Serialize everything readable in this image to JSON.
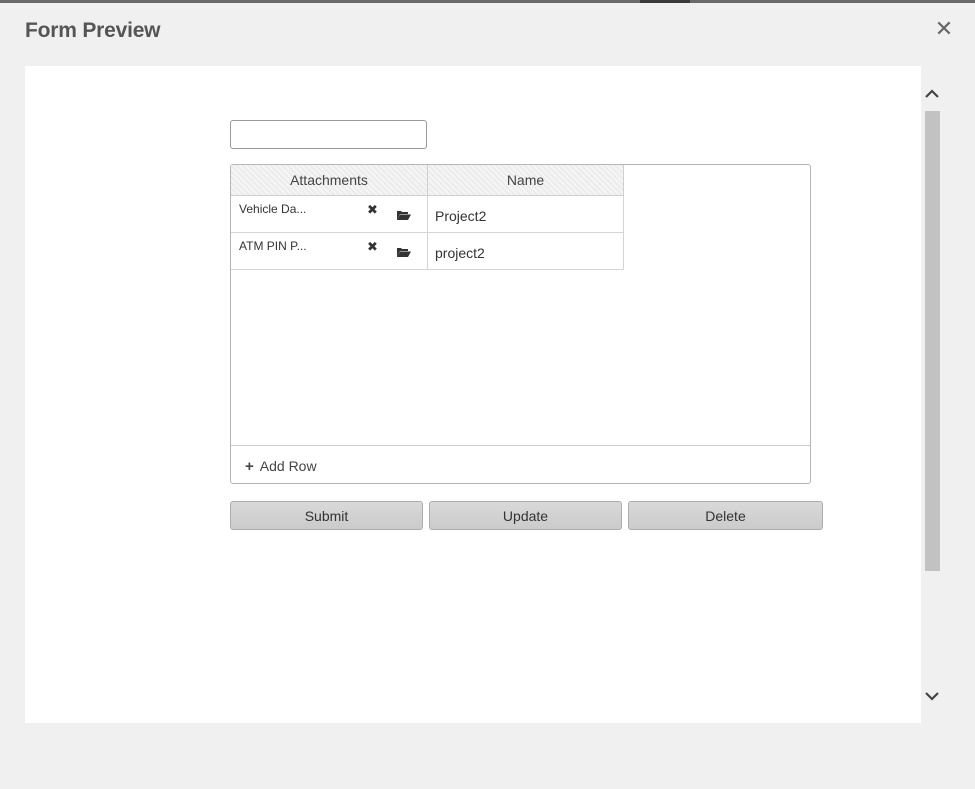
{
  "dialog": {
    "title": "Form Preview",
    "close_glyph": "✕"
  },
  "form": {
    "text_input": {
      "value": "",
      "placeholder": ""
    },
    "grid": {
      "columns": [
        "Attachments",
        "Name"
      ],
      "rows": [
        {
          "attachment": "Vehicle Da...",
          "name": "Project2",
          "remove_icon": "remove-icon",
          "folder_icon": "folder-open-icon"
        },
        {
          "attachment": "ATM PIN P...",
          "name": "project2",
          "remove_icon": "remove-icon",
          "folder_icon": "folder-open-icon"
        }
      ],
      "add_row_label": "Add Row",
      "add_row_glyph": "+",
      "remove_glyph": "✖"
    },
    "buttons": {
      "submit": "Submit",
      "update": "Update",
      "delete": "Delete"
    }
  },
  "colors": {
    "background": "#f0f0f0",
    "panel": "#ffffff",
    "button": "#d0d0d0",
    "scroll_thumb": "#c2c2c2"
  }
}
